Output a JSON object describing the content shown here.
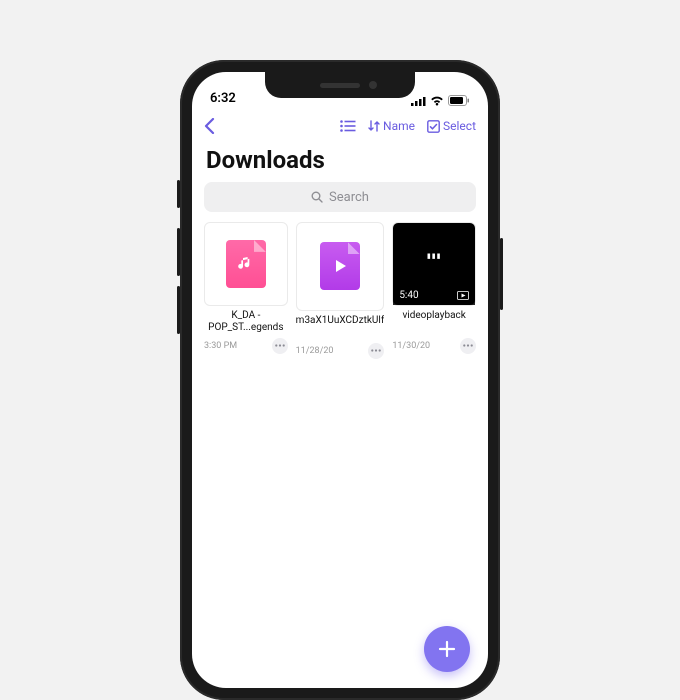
{
  "status": {
    "time": "6:32"
  },
  "toolbar": {
    "sort_label": "Name",
    "select_label": "Select"
  },
  "page": {
    "title": "Downloads"
  },
  "search": {
    "placeholder": "Search"
  },
  "items": [
    {
      "name": "K_DA - POP_ST...egends",
      "date": "3:30 PM",
      "kind": "music"
    },
    {
      "name": "m3aX1UuXCDztkUlf",
      "date": "11/28/20",
      "kind": "video"
    },
    {
      "name": "videoplayback",
      "date": "11/30/20",
      "kind": "videoblack",
      "duration": "5:40"
    }
  ],
  "colors": {
    "accent": "#6a5ce0",
    "fab": "#8274f0"
  }
}
